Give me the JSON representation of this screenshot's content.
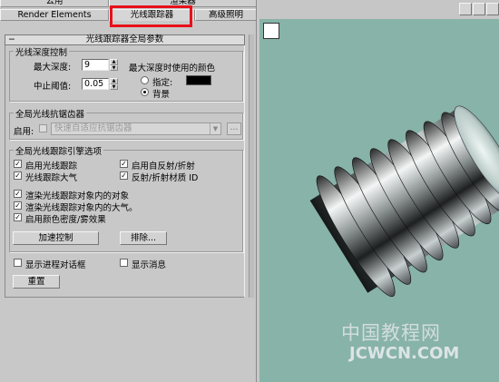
{
  "tabs_top": [
    "公用",
    "渲染器"
  ],
  "tabs": [
    {
      "label": "Render Elements"
    },
    {
      "label": "光线跟踪器",
      "active": true
    },
    {
      "label": "高级照明"
    }
  ],
  "rollout": {
    "title": "光线跟踪器全局参数"
  },
  "depth_group": {
    "title": "光线深度控制",
    "max_depth_label": "最大深度:",
    "max_depth_value": "9",
    "cutoff_label": "中止阈值:",
    "cutoff_value": "0.05",
    "color_title": "最大深度时使用的颜色",
    "specify_label": "指定:",
    "background_label": "背景",
    "selected_option": "背景",
    "specify_color": "#000000"
  },
  "antialias_group": {
    "title": "全局光线抗锯齿器",
    "enable_label": "启用:",
    "preset_value": "快速自适应抗锯齿器",
    "more_button": "..."
  },
  "engine_group": {
    "title": "全局光线跟踪引擎选项",
    "options": [
      {
        "label": "启用光线跟踪",
        "checked": true
      },
      {
        "label": "启用自反射/折射",
        "checked": true
      },
      {
        "label": "光线跟踪大气",
        "checked": true
      },
      {
        "label": "反射/折射材质 ID",
        "checked": true
      },
      {
        "label": "渲染光线跟踪对象内的对象",
        "checked": true
      },
      {
        "label": "渲染光线跟踪对象内的大气。",
        "checked": true
      },
      {
        "label": "启用颜色密度/雾效果",
        "checked": true
      }
    ],
    "accel_button": "加速控制",
    "exclude_button": "排除..."
  },
  "footer": {
    "show_progress_label": "显示进程对话框",
    "show_progress_checked": false,
    "show_messages_label": "显示消息",
    "show_messages_checked": false,
    "reset_button": "重置"
  },
  "viewport": {
    "background_color": "#88b3a8",
    "watermark_cn": "中国教程网",
    "watermark_url": "JCWCN.COM"
  },
  "colors": {
    "highlight": "#e8101a",
    "panel_bg": "#c8c8c8"
  }
}
